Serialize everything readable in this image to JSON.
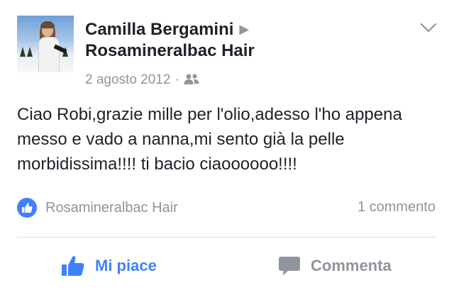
{
  "post": {
    "author": "Camilla Bergamini",
    "target_page": "Rosamineralbac Hair",
    "date": "2 agosto 2012",
    "separator": "·",
    "audience_icon": "friends-icon",
    "text": "Ciao Robi,grazie mille per l'olio,adesso l'ho appena messo e vado a nanna,mi sento già la pelle morbidissima!!!! ti bacio ciaoooooo!!!!"
  },
  "reactions": {
    "liked_by": "Rosamineralbac Hair",
    "comments": "1 commento"
  },
  "actions": {
    "like_label": "Mi piace",
    "comment_label": "Commenta"
  },
  "colors": {
    "accent": "#4080ff",
    "muted": "#90949c",
    "text": "#1d2129",
    "divider": "#dadde1"
  }
}
